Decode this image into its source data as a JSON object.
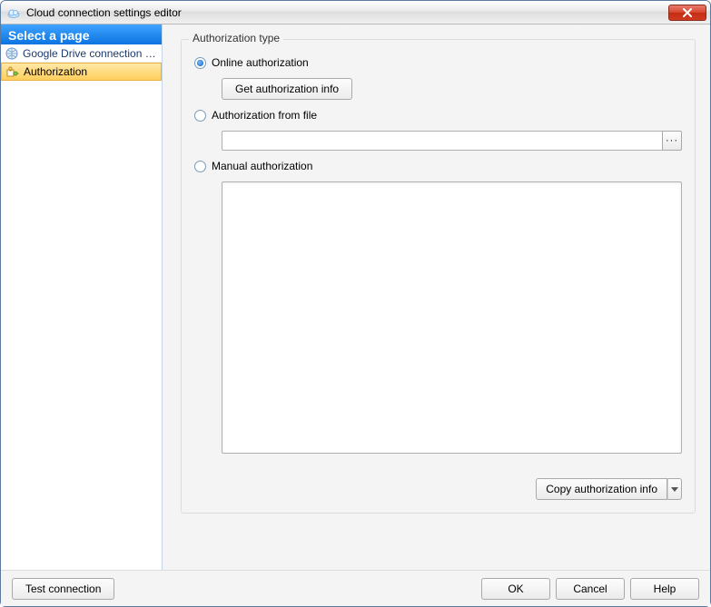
{
  "window": {
    "title": "Cloud connection settings editor"
  },
  "sidebar": {
    "heading": "Select a page",
    "items": [
      {
        "label": "Google Drive connection s…",
        "selected": false
      },
      {
        "label": "Authorization",
        "selected": true
      }
    ]
  },
  "group": {
    "title": "Authorization type",
    "options": {
      "online": {
        "label": "Online authorization",
        "checked": true,
        "button": "Get authorization info"
      },
      "from_file": {
        "label": "Authorization from file",
        "checked": false,
        "path": "",
        "browse_glyph": "···"
      },
      "manual": {
        "label": "Manual authorization",
        "checked": false,
        "text": ""
      }
    },
    "copy_button": "Copy authorization info"
  },
  "footer": {
    "test": "Test connection",
    "ok": "OK",
    "cancel": "Cancel",
    "help": "Help"
  }
}
